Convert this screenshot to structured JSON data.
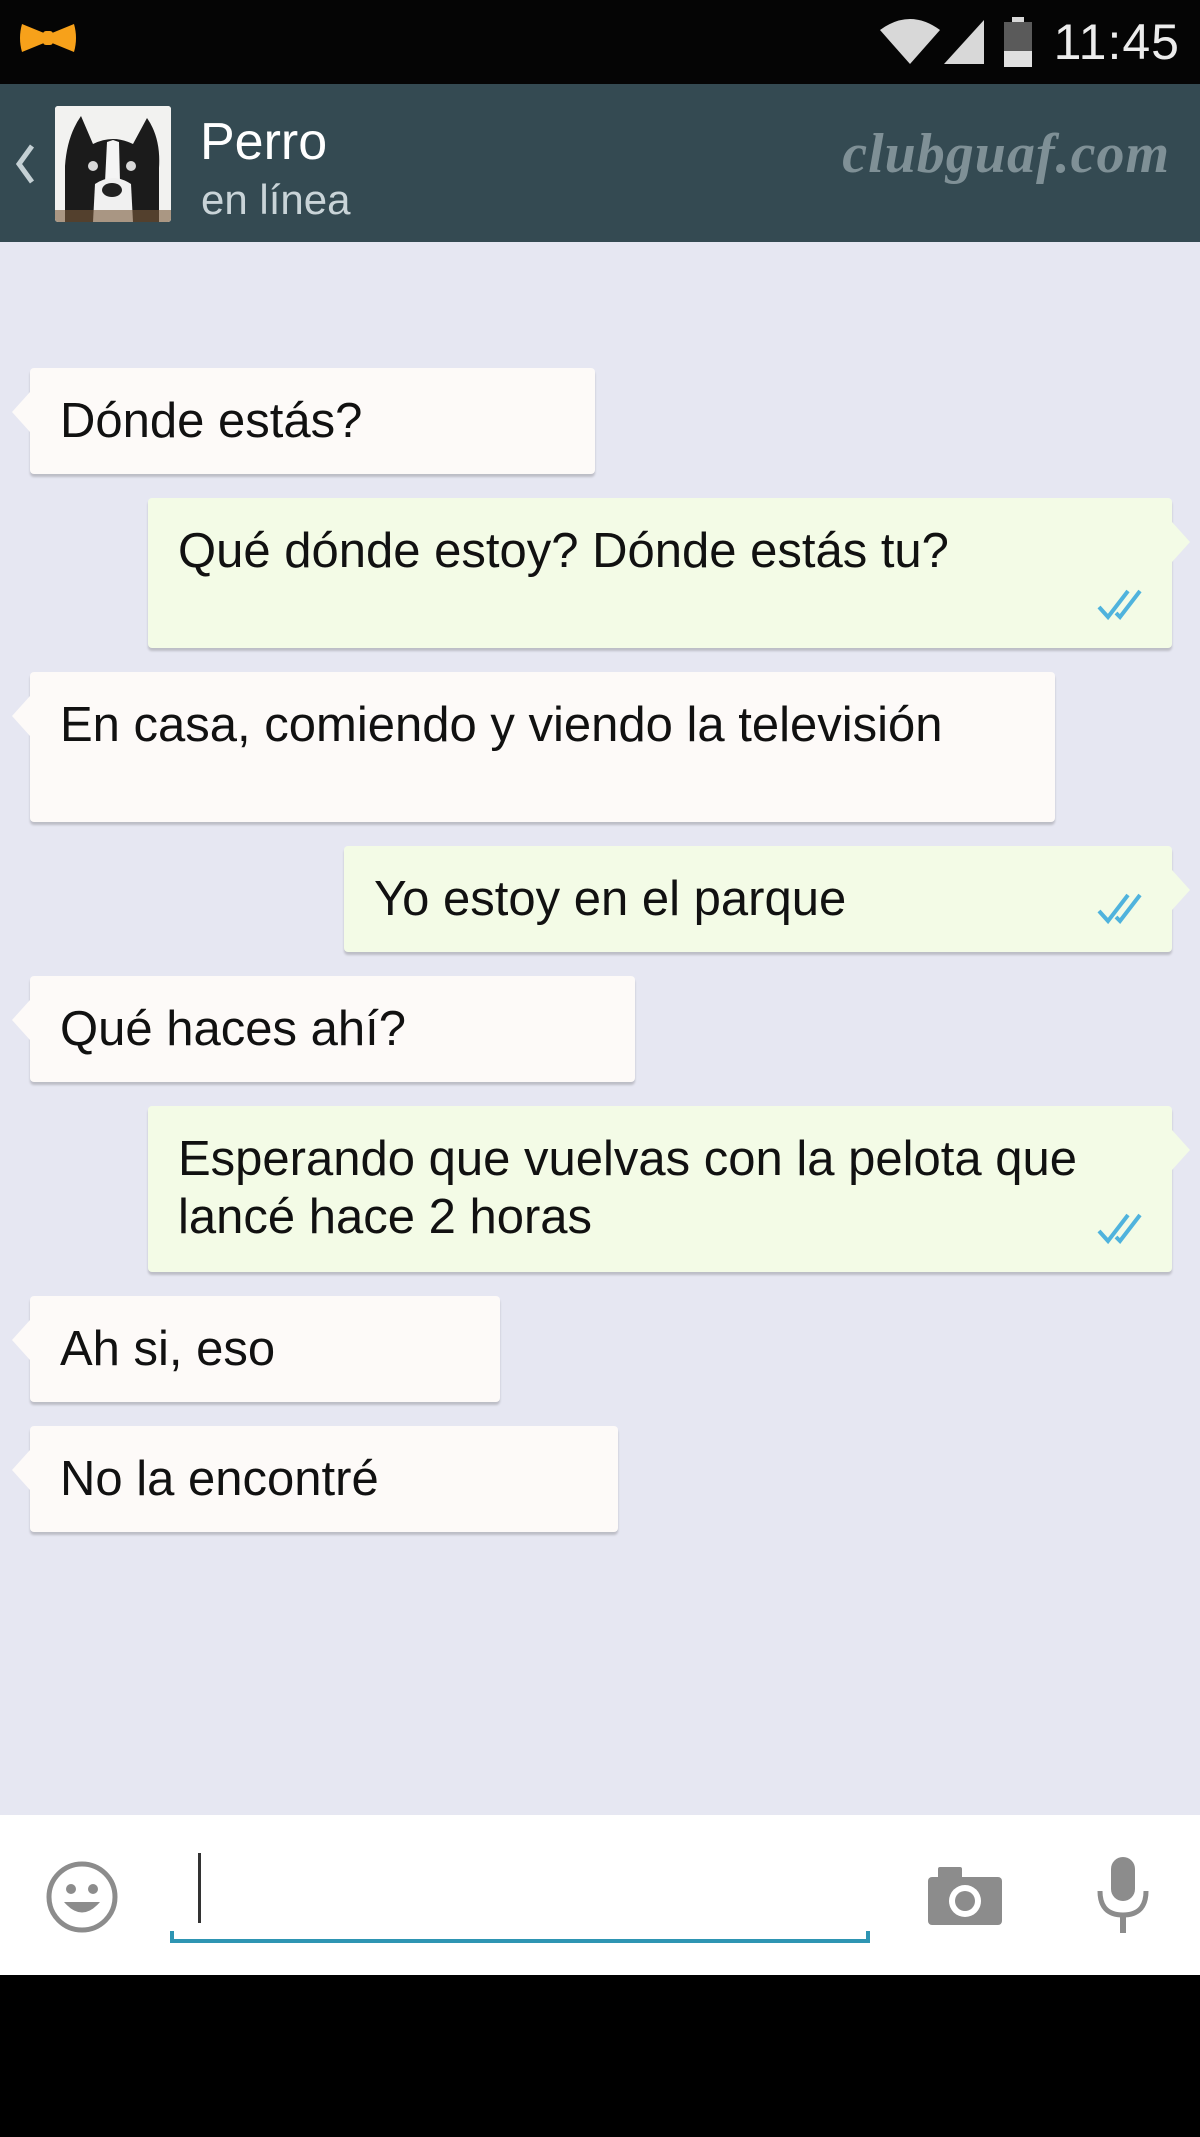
{
  "status_bar": {
    "time": "11:45"
  },
  "header": {
    "contact_name": "Perro",
    "contact_status": "en línea",
    "watermark": "clubguaf.com"
  },
  "messages": [
    {
      "direction": "incoming",
      "text": "Dónde estás?"
    },
    {
      "direction": "outgoing",
      "text": "Qué dónde estoy? Dónde estás tu?",
      "read": true
    },
    {
      "direction": "incoming",
      "text": "En casa, comiendo y viendo la televisión"
    },
    {
      "direction": "outgoing",
      "text": "Yo estoy en el parque",
      "read": true
    },
    {
      "direction": "incoming",
      "text": "Qué haces ahí?"
    },
    {
      "direction": "outgoing",
      "text_lines": [
        "Esperando que vuelvas con la pelota que",
        "lancé hace 2 horas"
      ],
      "read": true
    },
    {
      "direction": "incoming",
      "text": "Ah si, eso"
    },
    {
      "direction": "incoming",
      "text": "No la encontré"
    }
  ],
  "input": {
    "value": "",
    "placeholder": ""
  },
  "icons": {
    "notification": "bow-tie-icon",
    "wifi": "wifi-icon",
    "signal": "signal-icon",
    "battery": "battery-icon",
    "back": "chevron-left-icon",
    "emoji": "smiley-icon",
    "camera": "camera-icon",
    "mic": "microphone-icon",
    "read_receipt": "double-check-icon"
  },
  "colors": {
    "action_bar": "#344a52",
    "chat_background": "#e6e7f2",
    "incoming_bubble": "#fdfaf8",
    "outgoing_bubble": "#f3fbe6",
    "read_ticks": "#4fb3dd",
    "input_underline": "#2e95b3"
  }
}
